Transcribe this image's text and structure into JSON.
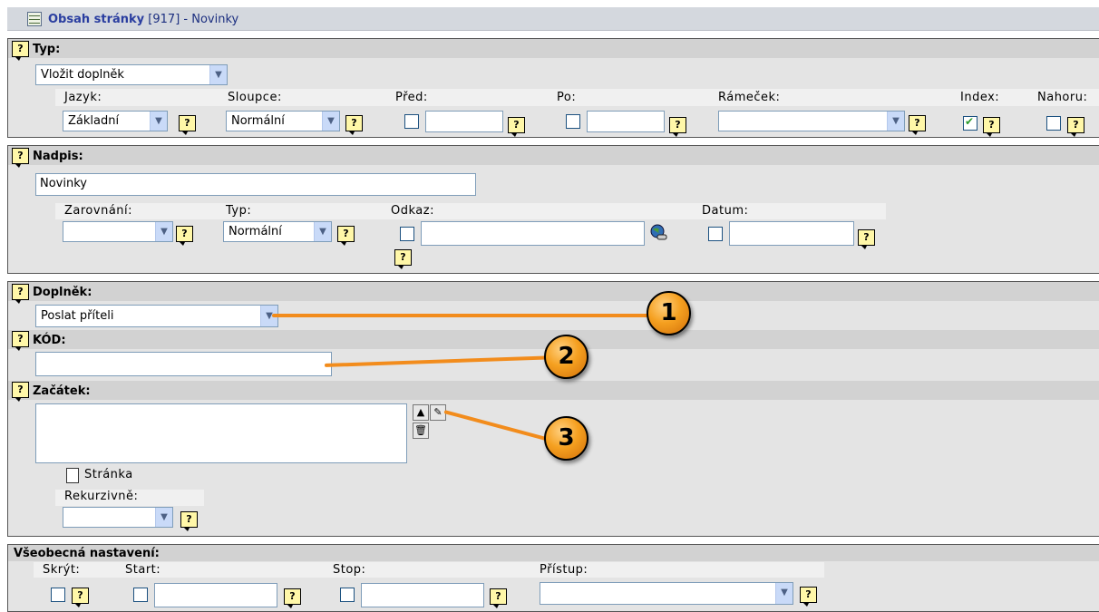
{
  "header": {
    "title_bold": "Obsah stránky",
    "title_rest": " [917] - Novinky"
  },
  "typ_panel": {
    "label": "Typ:",
    "type_select": "Vložit doplněk",
    "fields": {
      "jazyk": {
        "label": "Jazyk:",
        "value": "Základní"
      },
      "sloupce": {
        "label": "Sloupce:",
        "value": "Normální"
      },
      "pred": {
        "label": "Před:",
        "checked": false,
        "value": ""
      },
      "po": {
        "label": "Po:",
        "checked": false,
        "value": ""
      },
      "ramecek": {
        "label": "Rámeček:",
        "value": ""
      },
      "index": {
        "label": "Index:",
        "checked": true
      },
      "nahoru": {
        "label": "Nahoru:",
        "checked": false
      }
    }
  },
  "nadpis_panel": {
    "label": "Nadpis:",
    "value": "Novinky",
    "fields": {
      "zarovnani": {
        "label": "Zarovnání:",
        "value": ""
      },
      "typ": {
        "label": "Typ:",
        "value": "Normální"
      },
      "odkaz": {
        "label": "Odkaz:",
        "value": ""
      },
      "datum": {
        "label": "Datum:",
        "value": ""
      }
    }
  },
  "doplnek_panel": {
    "label": "Doplněk:",
    "addon_select": "Poslat příteli",
    "kod_label": "KÓD:",
    "kod_value": "",
    "zacatek_label": "Začátek:",
    "page_item": "Stránka",
    "rekurzivne_label": "Rekurzivně:",
    "rekurzivne_value": ""
  },
  "callouts": [
    "1",
    "2",
    "3"
  ],
  "vseobecna_panel": {
    "label": "Všeobecná nastavení:",
    "fields": {
      "skryt": {
        "label": "Skrýt:",
        "checked": false
      },
      "start": {
        "label": "Start:",
        "checked": false,
        "value": ""
      },
      "stop": {
        "label": "Stop:",
        "checked": false,
        "value": ""
      },
      "pristup": {
        "label": "Přístup:",
        "value": ""
      }
    }
  },
  "help_glyph": "?",
  "icons": {
    "title": "table-icon",
    "help": "help-bubble-icon",
    "link": "globe-link-icon",
    "page": "page-icon",
    "up": "move-up-icon",
    "trash": "trash-icon",
    "open": "open-folder-icon"
  },
  "colors": {
    "panel_bg": "#e4e4e4",
    "header_bg": "#d2d2d2",
    "callout": "#f28c1c",
    "title_text": "#1c2f80"
  }
}
